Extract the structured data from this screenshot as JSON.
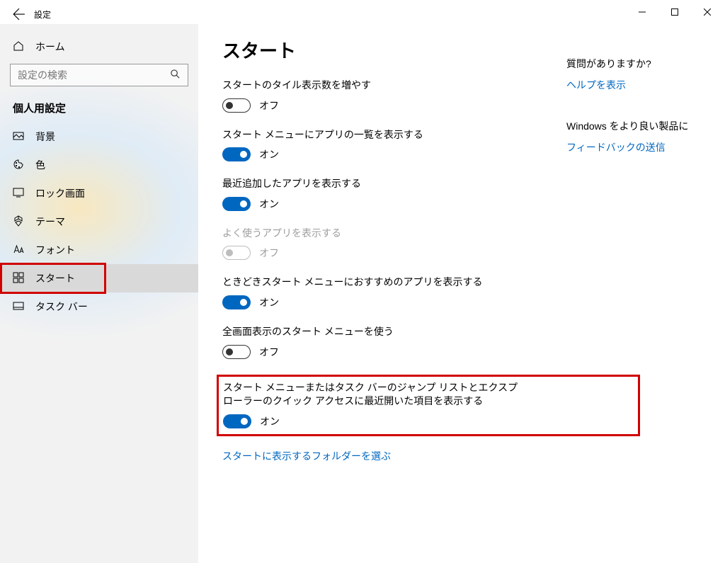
{
  "titlebar": {
    "title": "設定"
  },
  "sidebar": {
    "home": "ホーム",
    "searchPlaceholder": "設定の検索",
    "sectionHeader": "個人用設定",
    "items": [
      {
        "icon": "background",
        "label": "背景"
      },
      {
        "icon": "color",
        "label": "色"
      },
      {
        "icon": "lockscreen",
        "label": "ロック画面"
      },
      {
        "icon": "theme",
        "label": "テーマ"
      },
      {
        "icon": "font",
        "label": "フォント"
      },
      {
        "icon": "start",
        "label": "スタート",
        "selected": true,
        "highlighted": true
      },
      {
        "icon": "taskbar",
        "label": "タスク バー"
      }
    ]
  },
  "main": {
    "title": "スタート",
    "settings": [
      {
        "label": "スタートのタイル表示数を増やす",
        "on": false,
        "state": "オフ"
      },
      {
        "label": "スタート メニューにアプリの一覧を表示する",
        "on": true,
        "state": "オン"
      },
      {
        "label": "最近追加したアプリを表示する",
        "on": true,
        "state": "オン"
      },
      {
        "label": "よく使うアプリを表示する",
        "on": false,
        "state": "オフ",
        "disabled": true
      },
      {
        "label": "ときどきスタート メニューにおすすめのアプリを表示する",
        "on": true,
        "state": "オン"
      },
      {
        "label": "全画面表示のスタート メニューを使う",
        "on": false,
        "state": "オフ"
      },
      {
        "label": "スタート メニューまたはタスク バーのジャンプ リストとエクスプローラーのクイック アクセスに最近開いた項目を表示する",
        "on": true,
        "state": "オン",
        "highlighted": true
      }
    ],
    "link": "スタートに表示するフォルダーを選ぶ"
  },
  "aside": {
    "help": {
      "title": "質問がありますか?",
      "link": "ヘルプを表示"
    },
    "feedback": {
      "title": "Windows をより良い製品に",
      "link": "フィードバックの送信"
    }
  }
}
